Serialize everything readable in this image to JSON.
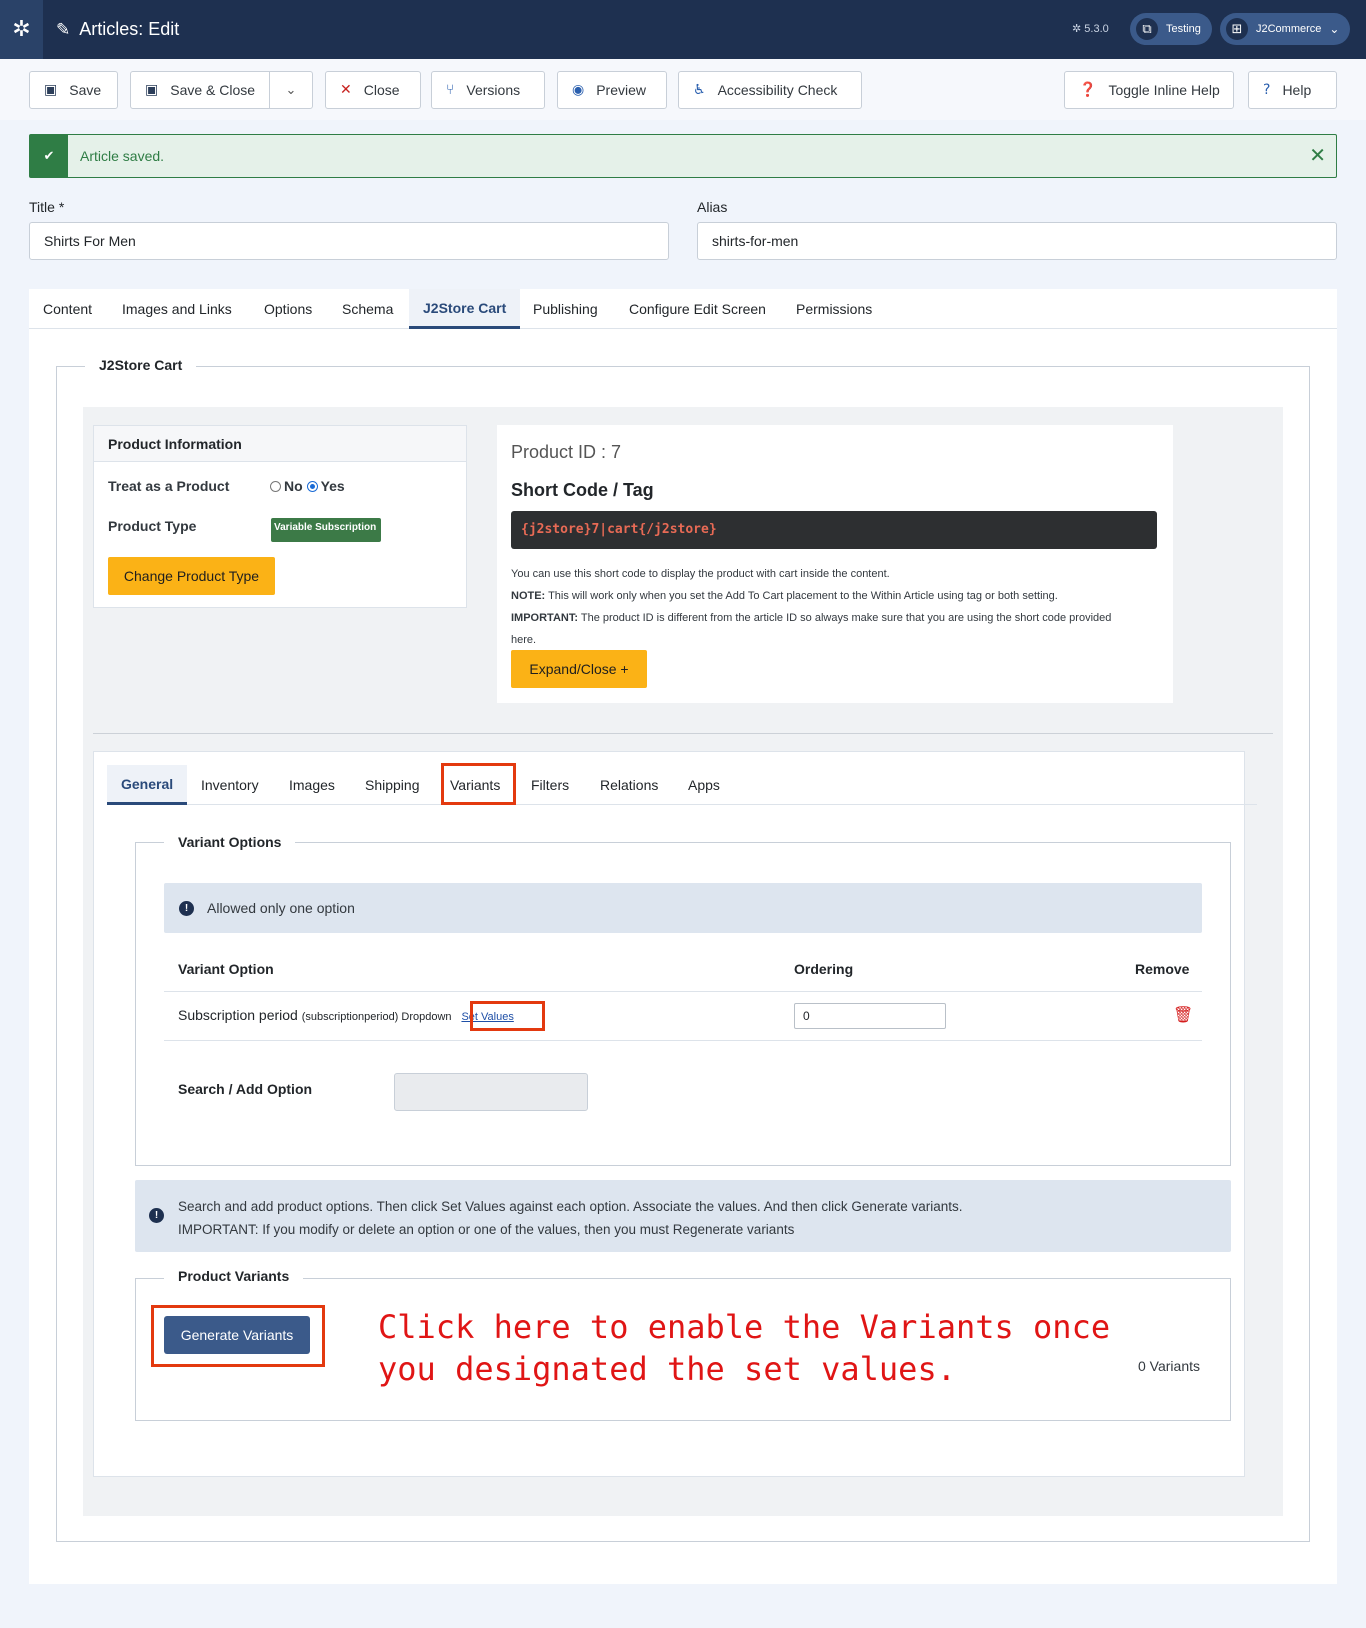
{
  "header": {
    "title": "Articles: Edit",
    "version": "5.3.0",
    "site_link": "Testing",
    "user_menu": "J2Commerce"
  },
  "toolbar": {
    "save": "Save",
    "save_close": "Save & Close",
    "close": "Close",
    "versions": "Versions",
    "preview": "Preview",
    "accessibility": "Accessibility Check",
    "toggle_help": "Toggle Inline Help",
    "help": "Help"
  },
  "alert": {
    "message": "Article saved."
  },
  "form": {
    "title_label": "Title *",
    "title_value": "Shirts For Men",
    "alias_label": "Alias",
    "alias_value": "shirts-for-men"
  },
  "tabs": [
    "Content",
    "Images and Links",
    "Options",
    "Schema",
    "J2Store Cart",
    "Publishing",
    "Configure Edit Screen",
    "Permissions"
  ],
  "cart": {
    "legend": "J2Store Cart",
    "product_info": {
      "heading": "Product Information",
      "treat_label": "Treat as a Product",
      "opt_no": "No",
      "opt_yes": "Yes",
      "selected": "Yes",
      "type_label": "Product Type",
      "type_value": "Variable Subscription",
      "change_button": "Change Product Type"
    },
    "shortcode": {
      "product_id": "Product ID : 7",
      "heading": "Short Code / Tag",
      "code": "{j2store}7|cart{/j2store}",
      "line1": "You can use this short code to display the product with cart inside the content.",
      "note_label": "NOTE:",
      "note_text": " This will work only when you set the Add To Cart placement to the Within Article using tag or both setting.",
      "important_label": "IMPORTANT:",
      "important_text": " The product ID is different from the article ID so always make sure that you are using the short code provided",
      "important_text2": "here.",
      "expand_button": "Expand/Close +"
    },
    "subtabs": [
      "General",
      "Inventory",
      "Images",
      "Shipping",
      "Variants",
      "Filters",
      "Relations",
      "Apps"
    ],
    "variant_options": {
      "legend": "Variant Options",
      "info": "Allowed only one option",
      "col_option": "Variant Option",
      "col_ordering": "Ordering",
      "col_remove": "Remove",
      "row_name": "Subscription period",
      "row_detail": "(subscriptionperiod) Dropdown",
      "row_link": "Set Values",
      "row_ordering": "0",
      "search_label": "Search / Add Option"
    },
    "help_text": {
      "line1": "Search and add product options. Then click Set Values against each option. Associate the values. And then click Generate variants.",
      "line2": "IMPORTANT: If you modify or delete an option or one of the values, then you must Regenerate variants"
    },
    "product_variants": {
      "legend": "Product Variants",
      "button": "Generate Variants",
      "count": "0 Variants"
    }
  },
  "annotation": {
    "line1": "Click here to enable the Variants once",
    "line2": "you designated the set values."
  },
  "colors": {
    "header_bg": "#1e3050",
    "success": "#2f7d45",
    "warning_button": "#fbb216",
    "primary_button": "#3b5a8a",
    "highlight": "#e3390f",
    "annotation": "#e01515"
  }
}
